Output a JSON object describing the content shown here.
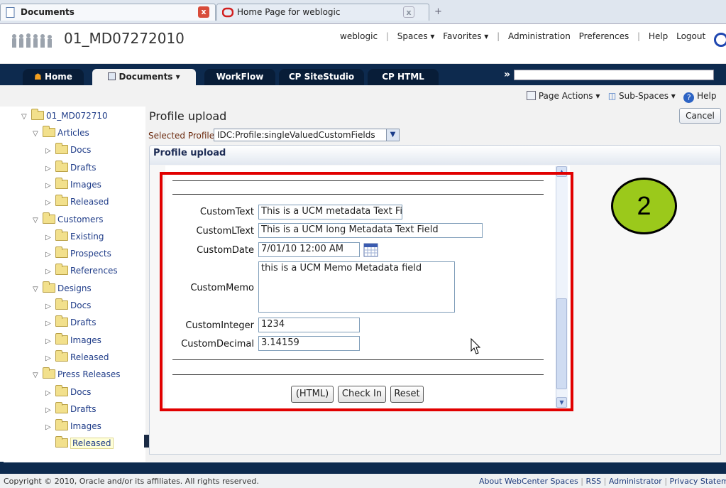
{
  "browser": {
    "tabs": [
      {
        "label": "Documents"
      },
      {
        "label": "Home Page for weblogic"
      }
    ],
    "close_glyph": "x",
    "new_tab_glyph": "+"
  },
  "header": {
    "title": "01_MD07272010",
    "nav": [
      "weblogic",
      "Spaces ▾",
      "Favorites ▾",
      "Administration",
      "Preferences",
      "Help",
      "Logout"
    ]
  },
  "main_tabs": [
    {
      "label": "Home"
    },
    {
      "label": "Documents ▾"
    },
    {
      "label": "WorkFlow"
    },
    {
      "label": "CP SiteStudio"
    },
    {
      "label": "CP HTML"
    }
  ],
  "overflow_glyph": "»",
  "toolbar": {
    "page_actions": "Page Actions ▾",
    "sub_spaces": "Sub-Spaces ▾",
    "help": "Help"
  },
  "tree": {
    "root": "01_MD072710",
    "items": [
      {
        "label": "Articles",
        "level": 1,
        "expanded": true
      },
      {
        "label": "Docs",
        "level": 2
      },
      {
        "label": "Drafts",
        "level": 2
      },
      {
        "label": "Images",
        "level": 2
      },
      {
        "label": "Released",
        "level": 2
      },
      {
        "label": "Customers",
        "level": 1,
        "expanded": true
      },
      {
        "label": "Existing",
        "level": 2
      },
      {
        "label": "Prospects",
        "level": 2
      },
      {
        "label": "References",
        "level": 2
      },
      {
        "label": "Designs",
        "level": 1,
        "expanded": true
      },
      {
        "label": "Docs",
        "level": 2
      },
      {
        "label": "Drafts",
        "level": 2
      },
      {
        "label": "Images",
        "level": 2
      },
      {
        "label": "Released",
        "level": 2
      },
      {
        "label": "Press Releases",
        "level": 1,
        "expanded": true
      },
      {
        "label": "Docs",
        "level": 2
      },
      {
        "label": "Drafts",
        "level": 2
      },
      {
        "label": "Images",
        "level": 2
      },
      {
        "label": "Released",
        "level": 2,
        "selected": true
      }
    ]
  },
  "content": {
    "title": "Profile upload",
    "cancel": "Cancel",
    "selected_profile_label": "Selected Profile",
    "selected_profile_value": "IDC:Profile:singleValuedCustomFields",
    "panel_title": "Profile upload"
  },
  "form": {
    "fields": [
      {
        "label": "CustomText",
        "value": "This is a UCM metadata Text Fi"
      },
      {
        "label": "CustomLText",
        "value": "This is a UCM long Metadata Text Field"
      },
      {
        "label": "CustomDate",
        "value": "7/01/10 12:00 AM"
      },
      {
        "label": "CustomMemo",
        "value": "this is a UCM Memo Metadata field"
      },
      {
        "label": "CustomInteger",
        "value": "1234"
      },
      {
        "label": "CustomDecimal",
        "value": "3.14159"
      }
    ],
    "buttons": {
      "html": "(HTML)",
      "checkin": "Check In",
      "reset": "Reset"
    }
  },
  "callout": "2",
  "footer": {
    "copyright": "Copyright © 2010, Oracle and/or its affiliates. All rights reserved.",
    "links": [
      "About WebCenter Spaces",
      "RSS",
      "Administrator",
      "Privacy Statement"
    ]
  },
  "colors": {
    "accent": "#0d2a4e",
    "highlight": "#e10000",
    "badge": "#9bc91b"
  }
}
